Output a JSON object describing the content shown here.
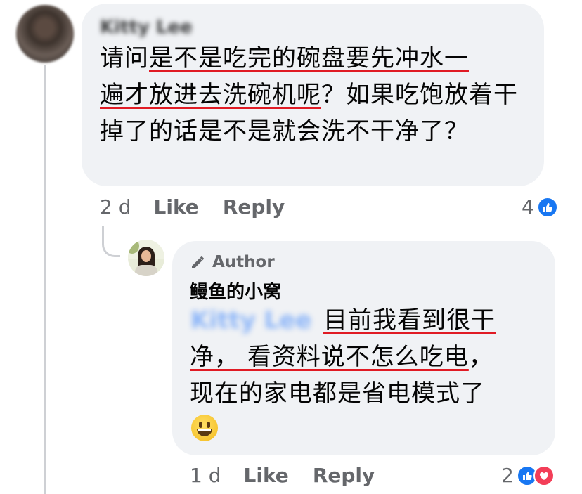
{
  "comment": {
    "author_name_blurred": "Kitty Lee",
    "text_plain_1": "请问",
    "text_underlined_1": "是不是吃完的碗盘要先冲水一",
    "text_underlined_2": "遍才放进去洗碗机呢",
    "text_plain_2": "？如果吃饱放着干掉了的话是不是就会洗不干净了？",
    "time": "2 d",
    "like_label": "Like",
    "reply_label": "Reply",
    "reaction_count": "4"
  },
  "reply": {
    "badge_label": "Author",
    "author_name": "鳗鱼的小窝",
    "mention_blurred": "Kitty Lee",
    "text_underlined_1": "目前我看到很干",
    "text_underlined_2": "净， 看资料说不怎么吃电",
    "text_plain_1": "，",
    "text_plain_2": "现在的家电都是省电模式了",
    "time": "1 d",
    "like_label": "Like",
    "reply_label": "Reply",
    "reaction_count": "2"
  },
  "colors": {
    "bubble_bg": "#f0f2f5",
    "underline": "#e01b24",
    "like_blue": "#1877f2",
    "love_red": "#f33e58",
    "meta_gray": "#65676b"
  },
  "icons": [
    "pencil-icon",
    "like-reaction-icon",
    "love-reaction-icon",
    "grinning-emoji-icon"
  ]
}
